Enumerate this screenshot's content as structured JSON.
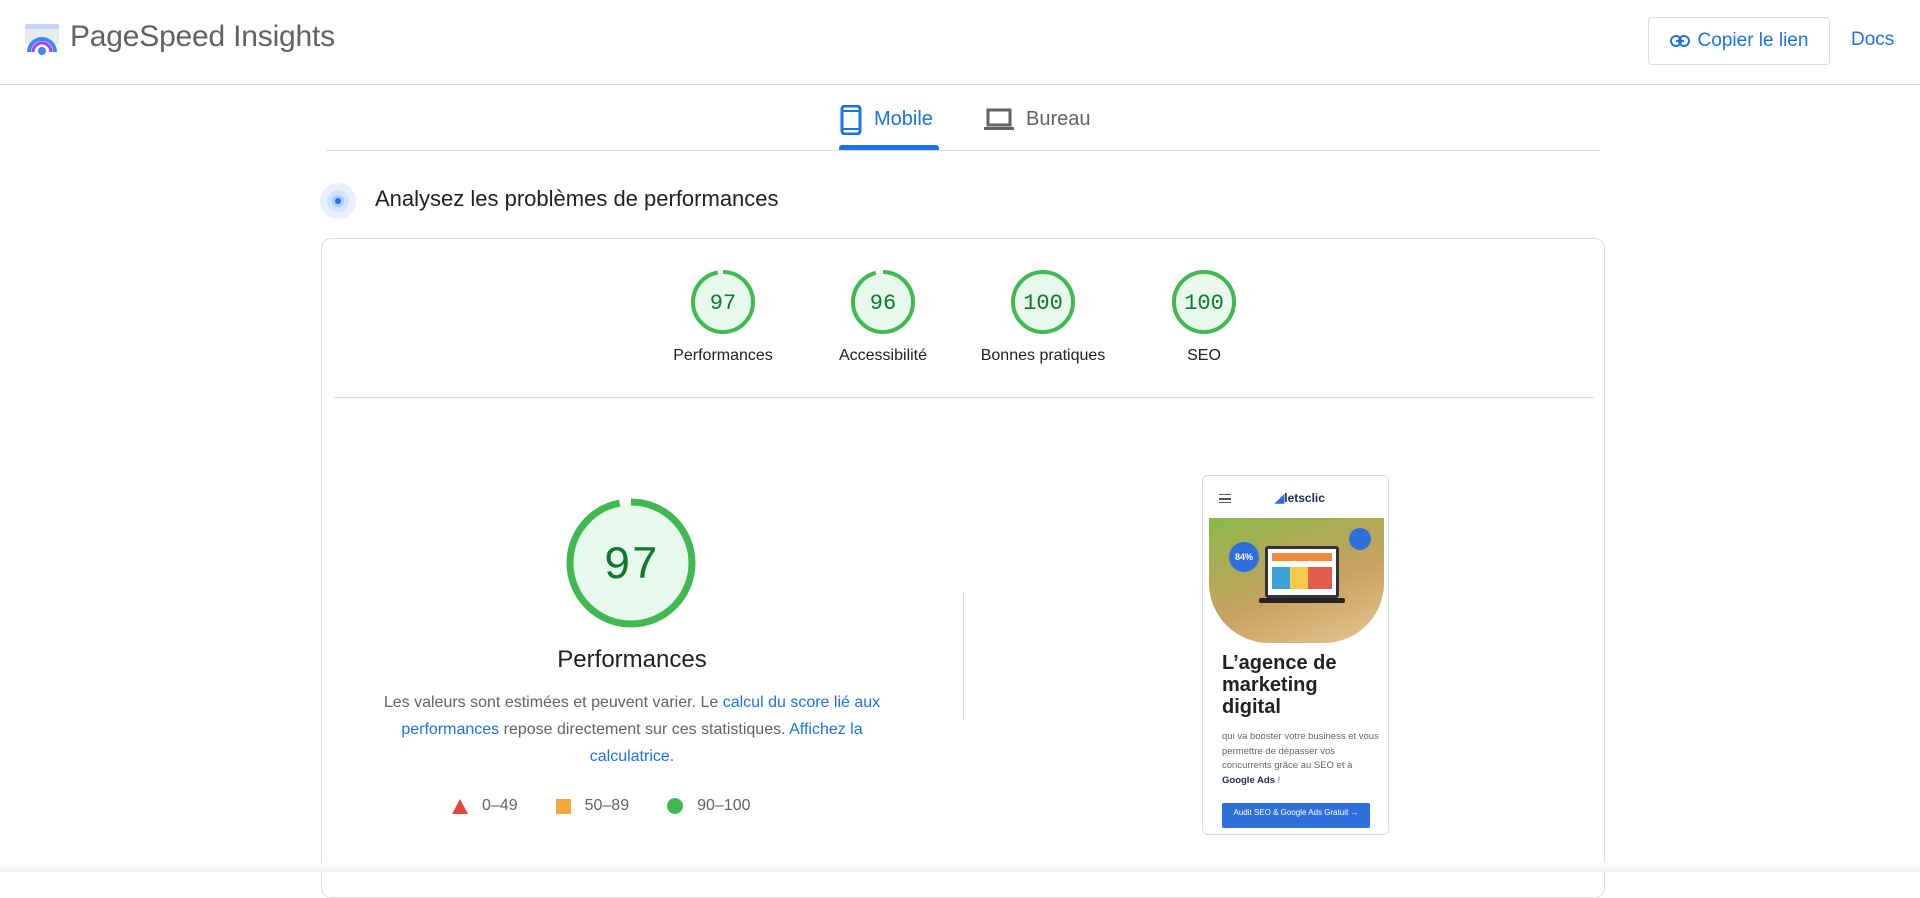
{
  "header": {
    "app_title": "PageSpeed Insights",
    "copy_link_label": "Copier le lien",
    "docs_label": "Docs"
  },
  "tabs": [
    {
      "label": "Mobile",
      "icon": "smartphone-icon",
      "active": true
    },
    {
      "label": "Bureau",
      "icon": "laptop-icon",
      "active": false
    }
  ],
  "section": {
    "title": "Analysez les problèmes de performances"
  },
  "scores": [
    {
      "value": "97",
      "label": "Performances",
      "fraction": 0.97
    },
    {
      "value": "96",
      "label": "Accessibilité",
      "fraction": 0.96
    },
    {
      "value": "100",
      "label": "Bonnes pratiques",
      "fraction": 1.0
    },
    {
      "value": "100",
      "label": "SEO",
      "fraction": 1.0
    }
  ],
  "performance": {
    "score": "97",
    "fraction": 0.97,
    "title": "Performances",
    "desc_part1": "Les valeurs sont estimées et peuvent varier. Le ",
    "desc_link1": "calcul du score lié aux performances",
    "desc_part2": " repose directement sur ces statistiques. ",
    "desc_link2": "Affichez la calculatrice."
  },
  "legend": [
    {
      "range": "0–49",
      "shape": "triangle",
      "color": "#e8453c"
    },
    {
      "range": "50–89",
      "shape": "square",
      "color": "#f4a93c"
    },
    {
      "range": "90–100",
      "shape": "circle",
      "color": "#3fb950"
    }
  ],
  "screenshot": {
    "brand_prefix": "",
    "brand": "letsclic",
    "badge": "84%",
    "heading": "L’agence de marketing digital",
    "text_part1": "qui va booster votre business et vous permettre de dépasser vos concurrents grâce au SEO et à ",
    "text_bold": "Google Ads",
    "text_part2": " !",
    "button": "Audit SEO & Google Ads Gratuit →"
  },
  "colors": {
    "accent": "#1a73e8",
    "pass_green": "#0cce6b",
    "pass_text": "#0d7a2f",
    "pass_fill": "#e8f8ec"
  }
}
